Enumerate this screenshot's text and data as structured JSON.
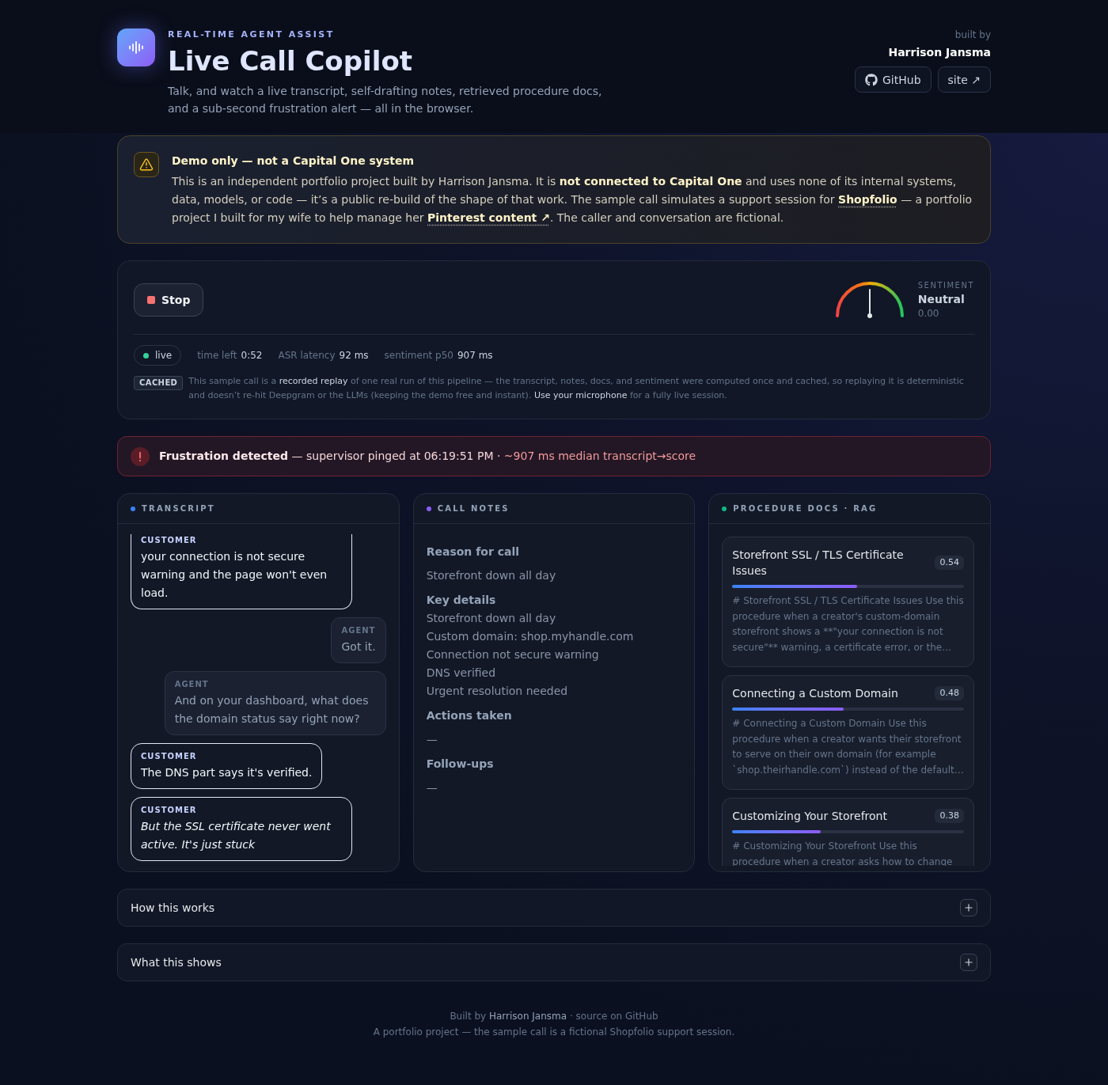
{
  "header": {
    "eyebrow": "REAL-TIME AGENT ASSIST",
    "title": "Live Call Copilot",
    "subtitle": "Talk, and watch a live transcript, self-drafting notes, retrieved procedure docs, and a sub-second frustration alert — all in the browser.",
    "built_by_label": "built by",
    "author": "Harrison Jansma",
    "links": [
      {
        "kind": "github",
        "label": "GitHub"
      },
      {
        "kind": "external",
        "label": "site ↗"
      }
    ]
  },
  "notice": {
    "title": "Demo only — not a Capital One system",
    "body": [
      {
        "kind": "text",
        "text": "This is an independent portfolio project built by Harrison Jansma. It is "
      },
      {
        "kind": "strong",
        "text": "not connected to Capital One"
      },
      {
        "kind": "text",
        "text": " and uses none of its internal systems, data, models, or code — it’s a public re-build of the shape of that work. The sample call simulates a support session for "
      },
      {
        "kind": "link",
        "text": "Shopfolio"
      },
      {
        "kind": "text",
        "text": " — a portfolio project I built for my wife to help manage her "
      },
      {
        "kind": "link",
        "text": "Pinterest content ↗"
      },
      {
        "kind": "text",
        "text": ". The caller and conversation are fictional."
      }
    ]
  },
  "call": {
    "button": "Stop",
    "sentiment": {
      "label": "SENTIMENT",
      "mood": "Neutral",
      "score": "0.00",
      "level": 0.5
    },
    "status": {
      "label": "live",
      "live": true
    },
    "stats": [
      {
        "label": "time left",
        "value": "0:52"
      },
      {
        "label": "ASR latency",
        "value": "92 ms"
      },
      {
        "label": "sentiment p50",
        "value": "907 ms"
      }
    ],
    "badge": "CACHED",
    "note": [
      {
        "kind": "text",
        "text": "This sample call is a "
      },
      {
        "kind": "highlight",
        "text": "recorded replay"
      },
      {
        "kind": "text",
        "text": " of one real run of this pipeline — the transcript, notes, docs, and sentiment were computed once and cached, so replaying it is deterministic and doesn’t re-hit Deepgram or the LLMs (keeping the demo free and instant). "
      },
      {
        "kind": "highlight",
        "text": "Use your microphone"
      },
      {
        "kind": "text",
        "text": " for a fully live session."
      }
    ]
  },
  "alert": {
    "title": "Frustration detected",
    "detail": "— supervisor pinged at 06:19:51 PM ·",
    "metric": "~907 ms median transcript→score"
  },
  "panels": [
    {
      "kind": "transcript",
      "title": "TRANSCRIPT",
      "color": "#3b82f6",
      "messages": [
        {
          "kind": "customer",
          "label": "CUSTOMER",
          "text": "your connection is not secure warning and the page won't even load.",
          "interim": false
        },
        {
          "kind": "agent",
          "label": "AGENT",
          "text": "Got it.",
          "interim": false
        },
        {
          "kind": "agent",
          "label": "AGENT",
          "text": "And on your dashboard, what does the domain status say right now?",
          "interim": false
        },
        {
          "kind": "customer",
          "label": "CUSTOMER",
          "text": "The DNS part says it's verified.",
          "interim": false
        },
        {
          "kind": "customer",
          "label": "CUSTOMER",
          "text": "But the SSL certificate never went active. It's just stuck",
          "interim": true
        }
      ]
    },
    {
      "kind": "notes",
      "title": "CALL NOTES",
      "color": "#8b5cf6",
      "sections": [
        {
          "kind": "text",
          "heading": "Reason for call",
          "items": [
            "Storefront down all day"
          ]
        },
        {
          "kind": "list",
          "heading": "Key details",
          "items": [
            "Storefront down all day",
            "Custom domain: shop.myhandle.com",
            "Connection not secure warning",
            "DNS verified",
            "Urgent resolution needed"
          ]
        },
        {
          "kind": "text",
          "heading": "Actions taken",
          "items": [
            "—"
          ]
        },
        {
          "kind": "text",
          "heading": "Follow-ups",
          "items": [
            "—"
          ]
        }
      ]
    },
    {
      "kind": "docs",
      "title": "PROCEDURE DOCS · RAG",
      "color": "#10b981",
      "docs": [
        {
          "title": "Storefront SSL / TLS Certificate Issues",
          "score": "0.54",
          "level": 0.54,
          "snippet": "# Storefront SSL / TLS Certificate Issues Use this procedure when a creator's custom-domain storefront shows a **\"your connection is not secure\"** warning, a certificate error, or the…"
        },
        {
          "title": "Connecting a Custom Domain",
          "score": "0.48",
          "level": 0.48,
          "snippet": "# Connecting a Custom Domain Use this procedure when a creator wants their storefront to serve on their own domain (for example `shop.theirhandle.com`) instead of the default…"
        },
        {
          "title": "Customizing Your Storefront",
          "score": "0.38",
          "level": 0.38,
          "snippet": "# Customizing Your Storefront Use this procedure when a creator asks how to change"
        }
      ]
    }
  ],
  "accordions": [
    {
      "title": "How this works",
      "expanded": false
    },
    {
      "title": "What this shows",
      "expanded": false
    }
  ],
  "footer": {
    "credit": [
      {
        "kind": "text",
        "text": "Built by "
      },
      {
        "kind": "author",
        "text": "Harrison Jansma"
      },
      {
        "kind": "text",
        "text": " · "
      },
      {
        "kind": "link",
        "text": "source on GitHub"
      }
    ],
    "note": "A portfolio project — the sample call is a fictional Shopfolio support session."
  }
}
